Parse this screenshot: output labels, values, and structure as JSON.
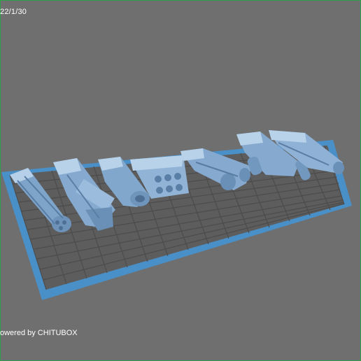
{
  "viewer": {
    "date_text": "22/1/30",
    "footer_text": "owered by CHITUBOX"
  },
  "colors": {
    "background": "#6f6f6f",
    "plate_border": "#4a90c8",
    "plate_fill": "#5e5e5e",
    "grid_line": "#4e4e4e",
    "model": "#8fb3d6",
    "model_shadow": "#5a7fa6",
    "frame": "#2fa04a"
  }
}
